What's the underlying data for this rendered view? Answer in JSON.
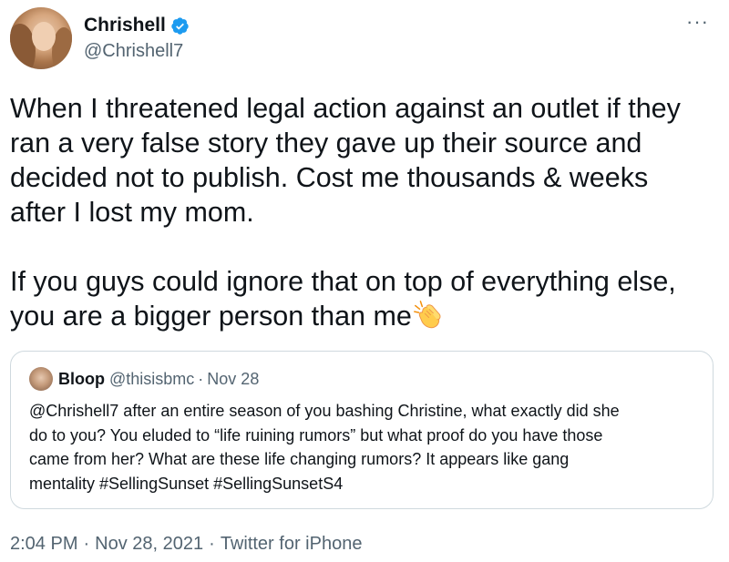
{
  "author": {
    "display_name": "Chrishell",
    "handle": "@Chrishell7",
    "verified_icon": "verified-badge-icon",
    "badge_color": "#1d9bf0"
  },
  "more_menu_glyph": "···",
  "tweet": {
    "paragraph1": "When I threatened legal action against an outlet if they\nran a very false story they gave up their source and\ndecided not to publish. Cost me thousands & weeks\nafter I lost my mom.",
    "paragraph2_line1": "If you guys could ignore that on top of everything else,",
    "paragraph2_line2": "you are a bigger person than me",
    "emoji": "clapping-hands-icon"
  },
  "quoted_tweet": {
    "display_name": "Bloop",
    "handle": "@thisisbmc",
    "separator": "·",
    "date": "Nov 28",
    "text": "@Chrishell7 after an entire season of you bashing Christine, what exactly did she\ndo to you? You eluded to “life ruining rumors” but what proof do you have those\ncame from her? What are these life changing rumors? It appears like gang\nmentality #SellingSunset #SellingSunsetS4"
  },
  "footer": {
    "time": "2:04 PM",
    "separator": "·",
    "date": "Nov 28, 2021",
    "source": "Twitter for iPhone"
  },
  "colors": {
    "text": "#0f1419",
    "secondary": "#536471",
    "border": "#cfd9de"
  }
}
